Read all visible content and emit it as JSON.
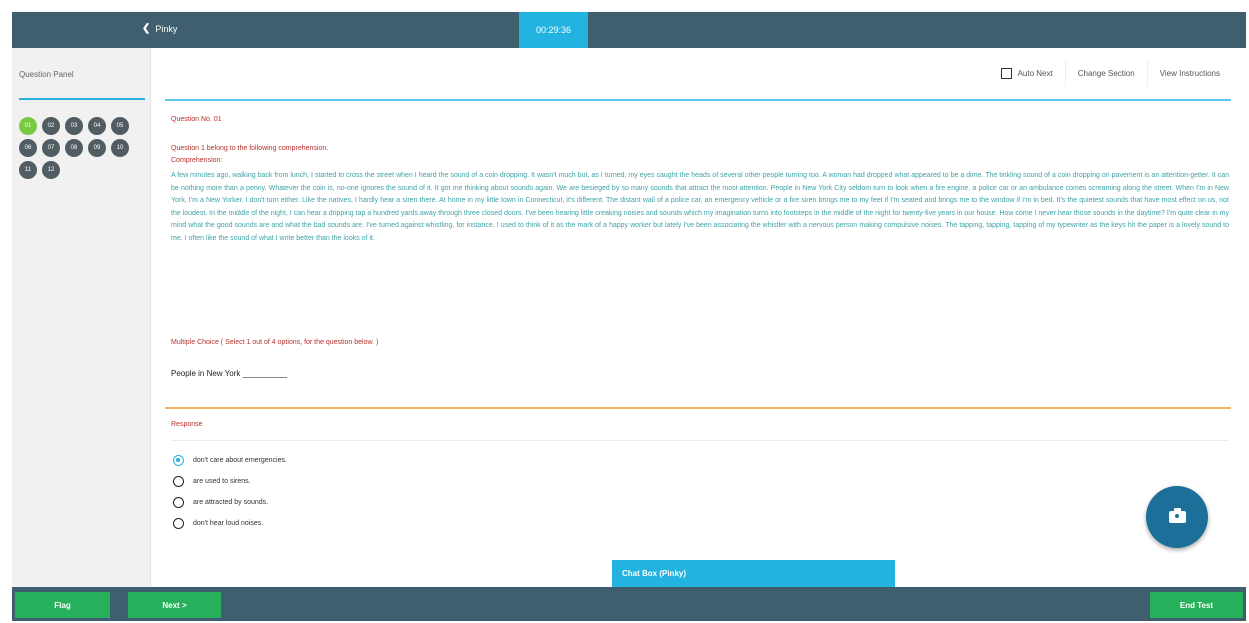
{
  "header": {
    "back_label": "Pinky",
    "timer": "00:29:36"
  },
  "question_panel": {
    "title": "Question Panel",
    "questions": [
      "01",
      "02",
      "03",
      "04",
      "05",
      "06",
      "07",
      "08",
      "09",
      "10",
      "11",
      "12"
    ],
    "current": "01"
  },
  "toolbar": {
    "auto_next_label": "Auto Next",
    "change_section_label": "Change Section",
    "view_instructions_label": "View Instructions"
  },
  "question": {
    "number_label": "Question No. 01",
    "intro": "Question 1 belong to the following comprehension.",
    "comprehension_label": "Comprehension:",
    "passage": "A few minutes ago, walking back from lunch, I started to cross the street when I heard the sound of a coin dropping. It wasn't much but, as I turned, my eyes caught the heads of several other people turning too. A woman had dropped what appeared to be a dime. The tinkling sound of a coin dropping on pavement is an attention-getter. It can be nothing more than a penny. Whatever the coin is, no-one ignores the sound of it. It got me thinking about sounds again. We are besieged by so many sounds that attract the most attention. People in New York City seldom turn to look when a fire engine, a police car or an ambulance comes screaming along the street. When I'm in New York, I'm a New Yorker. I don't turn either. Like the natives, I hardly hear a siren there. At home in my little town in Connecticut, it's different. The distant wail of a police car, an emergency vehicle or a fire siren brings me to my feet if I'm seated and brings me to the window if I'm in bed. It's the quietest sounds that have most effect on us, not the loudest. In the middle of the night, I can hear a dripping tap a hundred yards away through three closed doors. I've been hearing little creaking noises and sounds which my imagination turns into footsteps in the middle of the night for twenty-five years in our house. How come I never hear those sounds in the daytime? I'm quite clear in my mind what the good sounds are and what the bad sounds are. I've turned against whistling, for instance. I used to think of it as the mark of a happy worker but lately I've been associating the whistler with a nervous person making compulsive noises. The tapping, tapping, tapping of my typewriter as the keys hit the paper is a lovely sound to me. I often like the sound of what I write better than the looks of it.",
    "mcq_instruction": "Multiple Choice ( Select 1 out of 4 options, for the question below. )",
    "text": "People in New York __________"
  },
  "response": {
    "label": "Response",
    "options": [
      "don't care about emergencies.",
      "are used to sirens.",
      "are attracted by sounds.",
      "don't hear loud noises."
    ],
    "selected_index": 0
  },
  "chat": {
    "label": "Chat Box (Pinky)"
  },
  "footer": {
    "flag_label": "Flag",
    "next_label": "Next >",
    "end_label": "End Test"
  },
  "colors": {
    "accent": "#22b3e0",
    "bar": "#3f5f6e",
    "button": "#27b05b",
    "question_text": "#b5322e",
    "passage_text": "#3fa3a6"
  }
}
